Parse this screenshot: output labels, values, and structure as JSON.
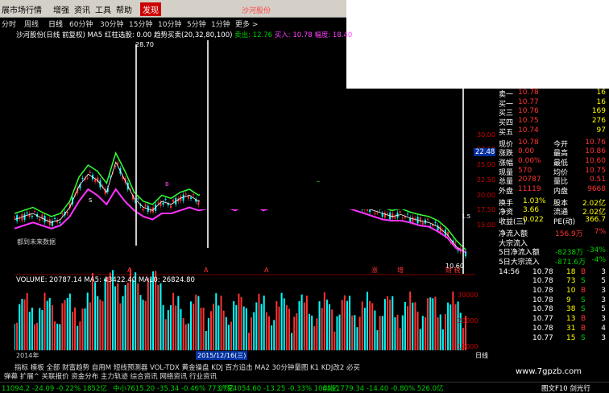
{
  "menu": {
    "items": [
      "展市场行情",
      "增强",
      "资讯",
      "工具",
      "帮助",
      "发现"
    ],
    "active_index": 5,
    "top_red_text": "沙河股份"
  },
  "periods": {
    "items": [
      "分时",
      "周线",
      "日线",
      "60分钟",
      "30分钟",
      "15分钟",
      "10分钟",
      "5分钟",
      "1分钟",
      "更多 >"
    ],
    "selected_index": 2
  },
  "chart_title": {
    "name": "沙河股份(日线 前复权)",
    "ma": "MA5",
    "red_pick": "红柱选股: 0.00",
    "trend": "趋势买卖(20,32,80,100)",
    "sell": "卖出: 12.76",
    "buy": "买入: 10.78",
    "amp": "幅度: 18.40"
  },
  "price_axis": [
    "30.00",
    "27.50",
    "25.00",
    "22.50",
    "20.00",
    "17.50",
    "15.00"
  ],
  "price_tag": "22.48",
  "peak_label": "28.70",
  "low_label": "10.60",
  "chart_text": {
    "no_future_data": "都到未来数据",
    "s_mark": "S",
    "b_mark": "B",
    "edge_label": "1.5"
  },
  "event_labels": [
    "A",
    "A",
    "A",
    "涨",
    "增",
    "财 税"
  ],
  "volume_header": {
    "vol": "VOLUME: 20787.14",
    "ma5": "MA5: 43422.40",
    "ma10": "MA10: 26824.80"
  },
  "volume_axis": [
    "30000",
    "20000",
    "10000"
  ],
  "date_axis": [
    "2014年",
    "2015/12/16(三)"
  ],
  "quotes": {
    "asks": [
      {
        "label": "卖一",
        "price": "10.78",
        "vol": "16"
      },
      {
        "label": "买一",
        "price": "10.77",
        "vol": "16"
      },
      {
        "label": "买三",
        "price": "10.76",
        "vol": "169"
      },
      {
        "label": "买四",
        "price": "10.75",
        "vol": "276"
      },
      {
        "label": "买五",
        "price": "10.74",
        "vol": "97"
      }
    ],
    "stats": [
      {
        "l1": "现价",
        "v1": "10.78",
        "l2": "今开",
        "v2": "10.76"
      },
      {
        "l1": "涨跌",
        "v1": "0.00",
        "l2": "最高",
        "v2": "10.86"
      },
      {
        "l1": "涨幅",
        "v1": "0.00%",
        "l2": "最低",
        "v2": "10.60"
      },
      {
        "l1": "现量",
        "v1": "570",
        "l2": "均价",
        "v2": "10.75"
      },
      {
        "l1": "总量",
        "v1": "20787",
        "l2": "量比",
        "v2": "0.51"
      },
      {
        "l1": "外盘",
        "v1": "11119",
        "l2": "内盘",
        "v2": "9668"
      }
    ],
    "fund": [
      {
        "l1": "换手",
        "v1": "1.03%",
        "l2": "股本",
        "v2": "2.02亿"
      },
      {
        "l1": "净资",
        "v1": "3.66",
        "l2": "流通",
        "v2": "2.02亿"
      },
      {
        "l1": "收益(三)",
        "v1": "0.022",
        "l2": "PE(动)",
        "v2": "366.7"
      }
    ],
    "flow": [
      {
        "l": "净流入额",
        "v": "156.9万",
        "p": "7%"
      },
      {
        "l": "大宗流入",
        "v": "",
        "p": ""
      },
      {
        "l": "5日净流入额",
        "v": "-8238万",
        "p": "-34%"
      },
      {
        "l": "5日大宗流入",
        "v": "-871.6万",
        "p": "-4%"
      }
    ],
    "ticks": [
      {
        "t": "14:56",
        "p": "10.78",
        "v": "18",
        "d": "B",
        "n": "3"
      },
      {
        "t": "",
        "p": "10.78",
        "v": "73",
        "d": "S",
        "n": "5"
      },
      {
        "t": "",
        "p": "10.78",
        "v": "10",
        "d": "B",
        "n": "3"
      },
      {
        "t": "",
        "p": "10.78",
        "v": "9",
        "d": "S",
        "n": "3"
      },
      {
        "t": "",
        "p": "10.78",
        "v": "38",
        "d": "S",
        "n": "5"
      },
      {
        "t": "",
        "p": "10.77",
        "v": "13",
        "d": "B",
        "n": "3"
      },
      {
        "t": "",
        "p": "10.78",
        "v": "31",
        "d": "B",
        "n": "4"
      },
      {
        "t": "",
        "p": "10.77",
        "v": "15",
        "d": "S",
        "n": "3"
      }
    ]
  },
  "tabs1": "指标 模板 全部 财富趋势 自用M 短线预测器 VOL-TDX 黄金操盘 KDJ 百方追击 MA2 30分钟量图 K1 KDJ改2 必买",
  "tabs2": "弹幕 扩展^ 关联报价 资金分布 主力轨迹 综合资讯 网络资讯 行业资讯",
  "side_box": "日线",
  "site": "www.7gpzb.com",
  "status": {
    "a": "11094.2 -24.09 -0.22% 1852亿",
    "b": "中小7615.20 -35.34 -0.46% 773.7亿",
    "c": "沪深4054.60 -13.25 -0.33% 1044亿",
    "d": "创业1779.34 -14.40 -0.80% 526.0亿",
    "e": "图文F10 剑光行"
  },
  "chart_data": {
    "type": "line",
    "series": [
      {
        "values": [
          17,
          17.5,
          18,
          17.2,
          16.5,
          17,
          19,
          23,
          25,
          24,
          22,
          27,
          24,
          20.5,
          19,
          18.5,
          20,
          19.5,
          20.5,
          21,
          20,
          20.8,
          21.5,
          20.5,
          20,
          21.5,
          21,
          20,
          20.5,
          21,
          20.2,
          20.6,
          21.8,
          22.2,
          21.8,
          21,
          20.5,
          19.8,
          19,
          18.5,
          18,
          17.5,
          17.8,
          17.2,
          16.8,
          16.5,
          15.8,
          14.5,
          12.5,
          11
        ]
      },
      {
        "values": [
          16,
          16.5,
          17,
          16.2,
          15.5,
          16,
          18,
          21.5,
          23.5,
          22.5,
          20.5,
          25.5,
          22.5,
          19.5,
          18,
          17.5,
          19,
          18.5,
          19.5,
          20,
          19,
          19.8,
          20.5,
          19.5,
          19,
          20.5,
          20,
          19,
          19.5,
          20,
          19.2,
          19.6,
          20.8,
          21.2,
          20.8,
          20,
          19.5,
          18.8,
          18,
          17.5,
          17,
          16.5,
          16.8,
          16.2,
          15.8,
          15.5,
          14.8,
          13.5,
          11.5,
          10.5
        ]
      },
      {
        "values": [
          14.5,
          15,
          15.5,
          15,
          14.5,
          15,
          16.5,
          19,
          21,
          20,
          18.5,
          21,
          19,
          17.5,
          16.5,
          16,
          17,
          17,
          17.5,
          18,
          17.5,
          17.8,
          18.5,
          18,
          17.5,
          18.5,
          18.5,
          17.5,
          18,
          18.5,
          18,
          18.2,
          19,
          19.2,
          19,
          18.5,
          18,
          17.5,
          17,
          16.5,
          16,
          15.8,
          15.8,
          15.5,
          15,
          14.8,
          14,
          13,
          11.2,
          10.6
        ]
      }
    ]
  }
}
